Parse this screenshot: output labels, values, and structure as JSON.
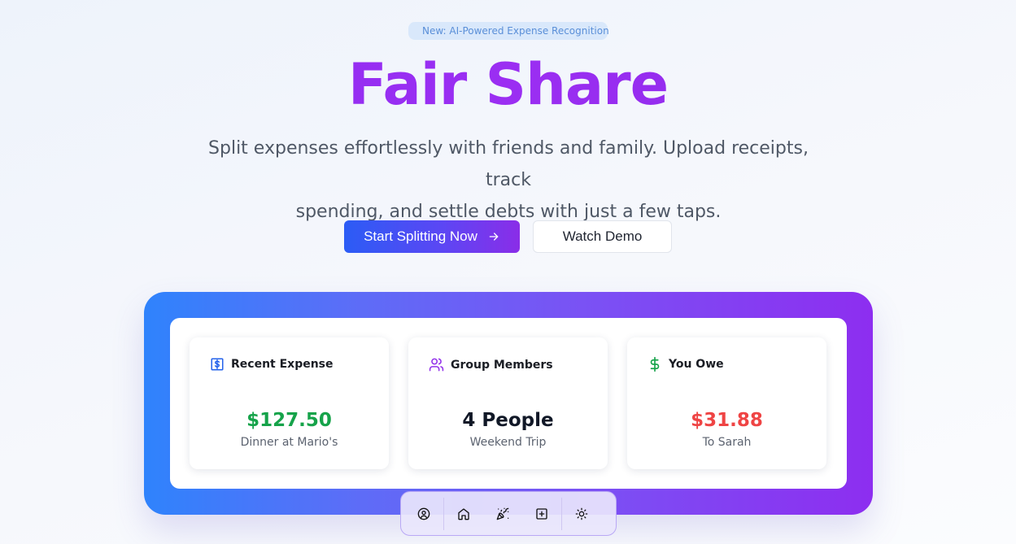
{
  "badge": {
    "icon": "star-icon",
    "text": "New: AI-Powered Expense Recognition"
  },
  "hero": {
    "title": "Fair Share",
    "subtitle_line1": "Split expenses effortlessly with friends and family. Upload receipts, track",
    "subtitle_line2": "spending, and settle debts with just a few taps."
  },
  "actions": {
    "primary_label": "Start Splitting Now",
    "primary_icon": "arrow-right-icon",
    "secondary_label": "Watch Demo"
  },
  "cards": [
    {
      "title": "Recent Expense",
      "icon": "receipt-dollar-icon",
      "value": "$127.50",
      "sub": "Dinner at Mario's",
      "value_color": "#16a34a",
      "icon_color": "#2563eb"
    },
    {
      "title": "Group Members",
      "icon": "users-icon",
      "value": "4 People",
      "sub": "Weekend Trip",
      "value_color": "#111827",
      "icon_color": "#9333ea"
    },
    {
      "title": "You Owe",
      "icon": "dollar-sign-icon",
      "value": "$31.88",
      "sub": "To Sarah",
      "value_color": "#ef4444",
      "icon_color": "#16a34a"
    }
  ],
  "dock": {
    "items": [
      "user-circle-icon",
      "home-icon",
      "party-popper-icon",
      "plus-square-icon",
      "sun-icon"
    ]
  },
  "colors": {
    "accent_purple": "#9333ea",
    "accent_blue": "#2f83fc"
  }
}
